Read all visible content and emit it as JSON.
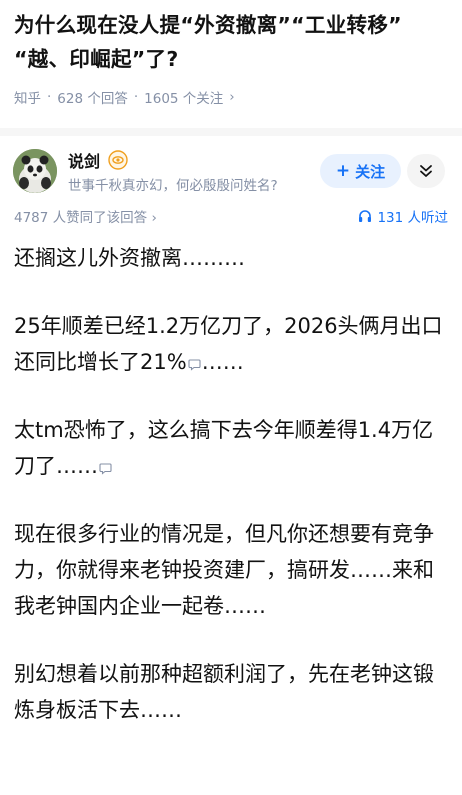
{
  "question": {
    "title_line1": "为什么现在没人提“外资撤离”“工业转移”",
    "title_line2": "“越、印崛起”了?",
    "source": "知乎",
    "answers": "628 个回答",
    "followers": "1605 个关注",
    "chevron": "›"
  },
  "author": {
    "name": "说剑",
    "bio": "世事千秋真亦幻，何必殷殷问姓名?",
    "follow_label": "关注",
    "follow_icon": "plus-icon",
    "more_icon": "chevron-double-down-icon",
    "accent_color": "#1772f6"
  },
  "stats": {
    "upvotes": "4787 人赞同了该回答",
    "chevron": "›",
    "listeners": "131 人听过"
  },
  "answer": {
    "p1": "还搁这儿外资撤离………",
    "p2_a": "25年顺差已经1.2万亿刀了，2026头俩月出口还同比增长了21%",
    "p2_b": "……",
    "p3_a": "太tm恐怖了，这么搞下去今年顺差得1.4万亿刀了……",
    "p4": "现在很多行业的情况是，但凡你还想要有竞争力，你就得来老钟投资建厂，搞研发……来和我老钟国内企业一起卷……",
    "p5": "别幻想着以前那种超额利润了，先在老钟这锻炼身板活下去……"
  }
}
